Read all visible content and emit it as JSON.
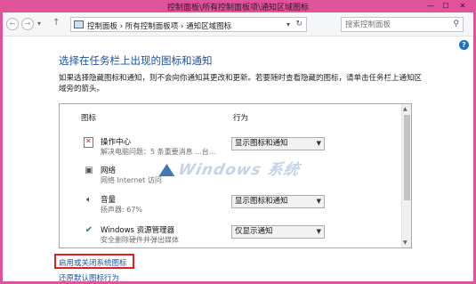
{
  "window": {
    "title": "控制面板\\所有控制面板项\\通知区域图标",
    "minimize": "—",
    "maximize": "☐",
    "close": "✕"
  },
  "address": {
    "back": "←",
    "forward": "→",
    "history": "▾",
    "up": "↑",
    "breadcrumb": "控制面板  ›  所有控制面板项  ›  通知区域图标",
    "dropdown": "▾",
    "refresh": "↻"
  },
  "search": {
    "placeholder": "搜索控制面板",
    "icon": "search-icon"
  },
  "help": "?",
  "heading": "选择在任务栏上出现的图标和通知",
  "description": "如果选择隐藏图标和通知，则不会向你通知其更改和更新。若要随时查看隐藏的图标，请单击任务栏上通知区域旁的箭头。",
  "table": {
    "col_icon": "图标",
    "col_behavior": "行为",
    "rows": [
      {
        "name": "操作中心",
        "sub": "解决电脑问题：5 条重要消息 ...台...",
        "icon": "action-center-icon",
        "behavior": "显示图标和通知"
      },
      {
        "name": "网络",
        "sub": "网络 Internet 访问",
        "icon": "network-icon",
        "behavior": ""
      },
      {
        "name": "音量",
        "sub": "扬声器: 67%",
        "icon": "speaker-icon",
        "behavior": "显示图标和通知"
      },
      {
        "name": "Windows 资源管理器",
        "sub": "安全删除硬件并弹出媒体",
        "icon": "safely-remove-icon",
        "behavior": "仅显示通知"
      }
    ]
  },
  "links": {
    "toggle_system_icons": "启用或关闭系统图标",
    "restore_defaults": "还原默认图标行为"
  },
  "watermark": "Windows  系统"
}
